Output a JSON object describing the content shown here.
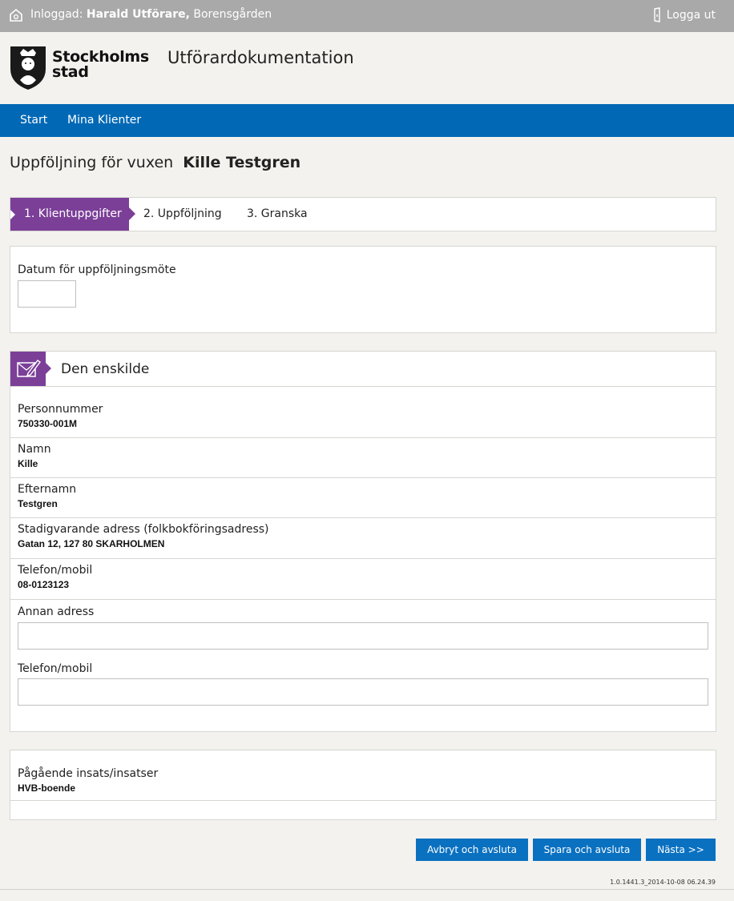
{
  "topbar": {
    "logged_prefix": "Inloggad:",
    "user_name": "Harald Utförare,",
    "unit": "Borensgården",
    "logout_label": "Logga ut"
  },
  "header": {
    "brand_line1": "Stockholms",
    "brand_line2": "stad",
    "app_title": "Utförardokumentation"
  },
  "nav": {
    "items": [
      {
        "label": "Start"
      },
      {
        "label": "Mina Klienter"
      }
    ]
  },
  "page": {
    "title_prefix": "Uppföljning för vuxen",
    "client_name": "Kille Testgren"
  },
  "steps": [
    {
      "label": "1. Klientuppgifter",
      "active": true
    },
    {
      "label": "2. Uppföljning",
      "active": false
    },
    {
      "label": "3. Granska",
      "active": false
    }
  ],
  "meeting": {
    "date_label": "Datum för uppföljningsmöte",
    "date_value": ""
  },
  "person_section": {
    "title": "Den enskilde",
    "fields": [
      {
        "label": "Personnummer",
        "value": "750330-001M"
      },
      {
        "label": "Namn",
        "value": "Kille"
      },
      {
        "label": "Efternamn",
        "value": "Testgren"
      },
      {
        "label": "Stadigvarande adress (folkbokföringsadress)",
        "value": "Gatan 12, 127 80 SKARHOLMEN"
      },
      {
        "label": "Telefon/mobil",
        "value": "08-0123123"
      }
    ],
    "other_address_label": "Annan adress",
    "other_address_value": "",
    "other_phone_label": "Telefon/mobil",
    "other_phone_value": ""
  },
  "interventions": {
    "label": "Pågående insats/insatser",
    "value": "HVB-boende"
  },
  "buttons": {
    "cancel": "Avbryt och avsluta",
    "save": "Spara och avsluta",
    "next": "Nästa >>"
  },
  "version": "1.0.1441.3_2014-10-08 06.24.39",
  "colors": {
    "topbar": "#a9a9a9",
    "nav": "#0068b5",
    "accent_purple": "#7b3f98",
    "button": "#0a71c1",
    "background": "#f3f2ee"
  }
}
